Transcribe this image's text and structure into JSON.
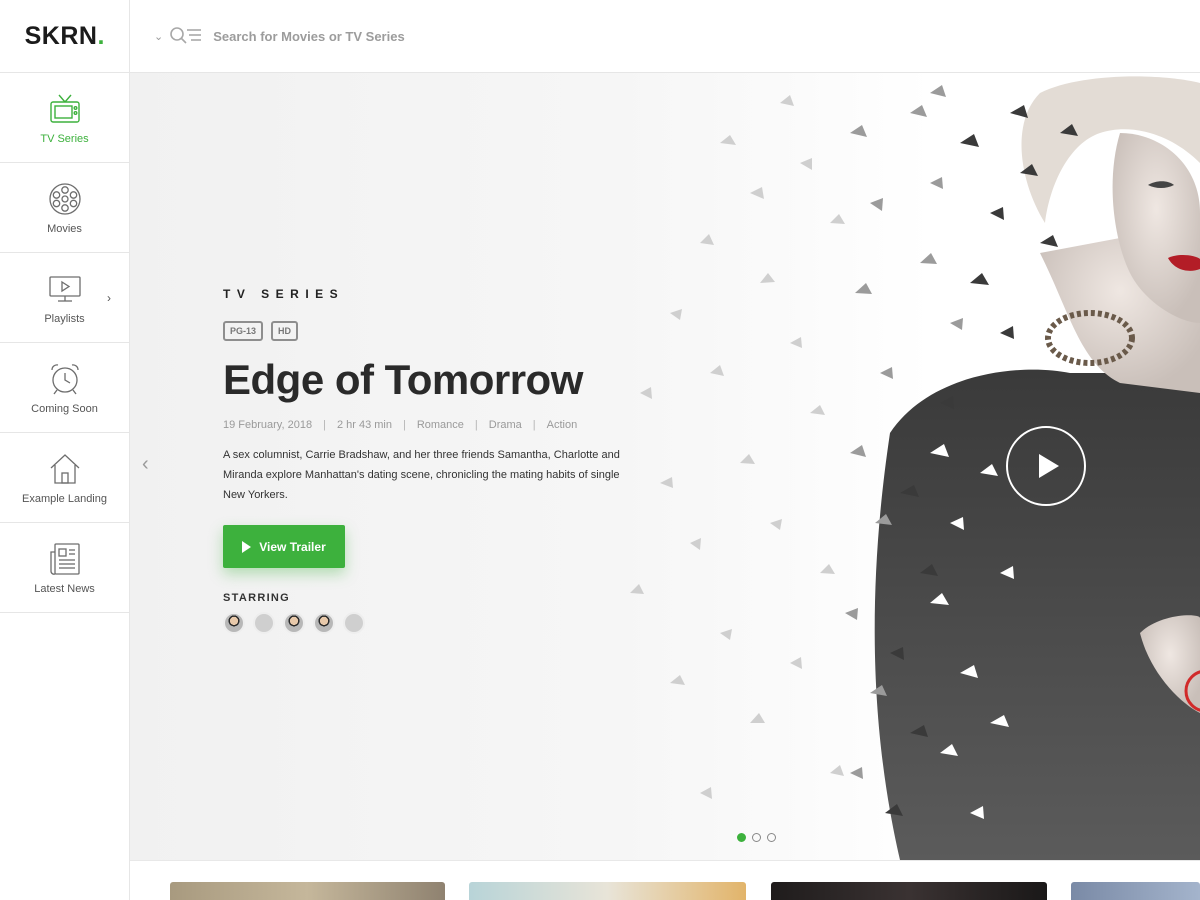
{
  "brand": {
    "name": "SKRN",
    "dot": "."
  },
  "colors": {
    "accent": "#3db13d",
    "title": "#2a2a2a",
    "muted": "#9a9a9a"
  },
  "sidebar": {
    "items": [
      {
        "label": "TV Series",
        "icon": "tv-icon",
        "active": true
      },
      {
        "label": "Movies",
        "icon": "film-reel-icon",
        "active": false
      },
      {
        "label": "Playlists",
        "icon": "monitor-play-icon",
        "active": false,
        "has_submenu": true
      },
      {
        "label": "Coming Soon",
        "icon": "alarm-clock-icon",
        "active": false
      },
      {
        "label": "Example Landing",
        "icon": "home-icon",
        "active": false
      },
      {
        "label": "Latest News",
        "icon": "newspaper-icon",
        "active": false
      }
    ]
  },
  "header": {
    "search_placeholder": "Search for Movies or TV Series"
  },
  "hero": {
    "category": "TV SERIES",
    "badges": [
      "PG-13",
      "HD"
    ],
    "title": "Edge of Tomorrow",
    "meta": [
      "19 February, 2018",
      "2 hr 43 min",
      "Romance",
      "Drama",
      "Action"
    ],
    "description": "A sex columnist, Carrie Bradshaw, and her three friends Samantha, Charlotte and Miranda explore Manhattan's dating scene, chronicling the mating habits of single New Yorkers.",
    "trailer_label": "View Trailer",
    "starring_label": "STARRING",
    "cast_count": 5,
    "slides": 3,
    "active_slide": 1
  }
}
